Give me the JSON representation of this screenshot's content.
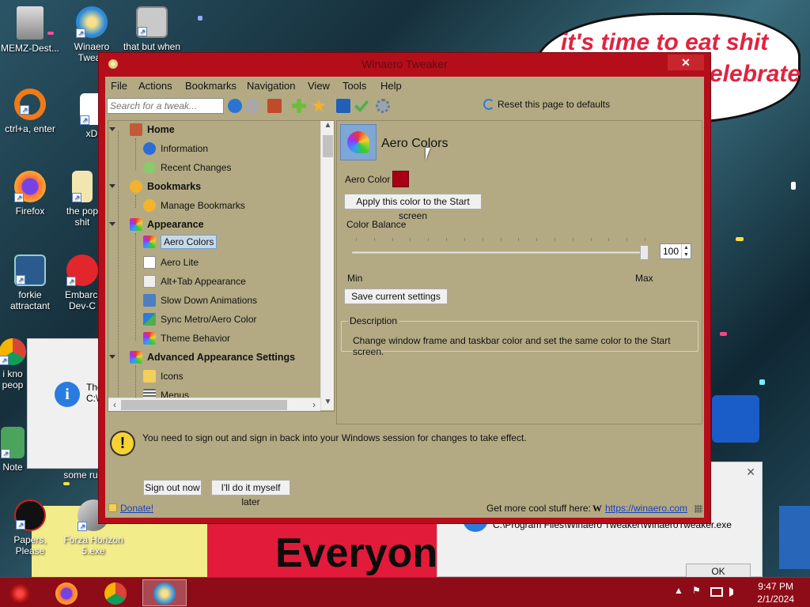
{
  "desktop": {
    "meme_text_1": "it's time to eat shit",
    "meme_text_2": "elebrate",
    "banner_text": "Everyon",
    "icons": [
      {
        "label": "MEMZ-Dest..."
      },
      {
        "label": "Winaero Tweak"
      },
      {
        "label": "that but when"
      },
      {
        "label": "ctrl+a, enter"
      },
      {
        "label": "xD"
      },
      {
        "label": "Firefox"
      },
      {
        "label": "the pop shit"
      },
      {
        "label": "forkie attractant"
      },
      {
        "label": "Embarca Dev-C"
      },
      {
        "label": "i kno peop"
      },
      {
        "label": "Note"
      },
      {
        "label": "some ru"
      },
      {
        "label": "Papers, Please"
      },
      {
        "label": "Forza Horizon 5.exe"
      }
    ],
    "bg_dialog_left_text": "The C:\\",
    "bg_dialog_right_path": "C:\\Program Files\\Winaero Tweaker\\WinaeroTweaker.exe",
    "bg_dialog_right_ok": "OK",
    "close_glyph": "✕"
  },
  "window": {
    "title": "Winaero Tweaker",
    "close_glyph": "✕",
    "menu": [
      "File",
      "Actions",
      "Bookmarks",
      "Navigation",
      "View",
      "Tools",
      "Help"
    ],
    "search_placeholder": "Search for a tweak...",
    "reset_label": "Reset this page to defaults"
  },
  "tree": {
    "nodes": [
      {
        "label": "Home",
        "level": 0,
        "icon": "home-icon"
      },
      {
        "label": "Information",
        "level": 1,
        "icon": "info-icon"
      },
      {
        "label": "Recent Changes",
        "level": 1,
        "icon": "recent-icon"
      },
      {
        "label": "Bookmarks",
        "level": 0,
        "icon": "star-icon"
      },
      {
        "label": "Manage Bookmarks",
        "level": 1,
        "icon": "star-icon"
      },
      {
        "label": "Appearance",
        "level": 0,
        "icon": "palette-icon"
      },
      {
        "label": "Aero Colors",
        "level": 1,
        "icon": "palette-icon",
        "selected": true
      },
      {
        "label": "Aero Lite",
        "level": 1,
        "icon": "window-icon"
      },
      {
        "label": "Alt+Tab Appearance",
        "level": 1,
        "icon": "alttab-icon"
      },
      {
        "label": "Slow Down Animations",
        "level": 1,
        "icon": "monitor-icon"
      },
      {
        "label": "Sync Metro/Aero Color",
        "level": 1,
        "icon": "sync-icon"
      },
      {
        "label": "Theme Behavior",
        "level": 1,
        "icon": "palette-icon"
      },
      {
        "label": "Advanced Appearance Settings",
        "level": 0,
        "icon": "palette-icon"
      },
      {
        "label": "Icons",
        "level": 1,
        "icon": "folder-icon"
      },
      {
        "label": "Menus",
        "level": 1,
        "icon": "menu-icon"
      }
    ]
  },
  "panel": {
    "title": "Aero Colors",
    "aero_color_label": "Aero Color",
    "aero_color_value": "#a80012",
    "apply_button": "Apply this color to the Start screen",
    "color_balance_label": "Color Balance",
    "slider_value": "100",
    "slider_fraction": 1.0,
    "min_label": "Min",
    "max_label": "Max",
    "save_button": "Save current settings",
    "description_legend": "Description",
    "description_text": "Change window frame and taskbar color and set the same color to the Start screen."
  },
  "notice": {
    "text": "You need to sign out and sign in back into your Windows session for changes to take effect.",
    "sign_out_button": "Sign out now",
    "later_button": "I'll do it myself later"
  },
  "footer": {
    "donate": "Donate!",
    "more_label": "Get more cool stuff here:",
    "w_glyph": "W",
    "url": "https://winaero.com"
  },
  "taskbar": {
    "time": "9:47 PM",
    "date": "2/1/2024",
    "up_arrow": "▲",
    "flag": "⚑"
  },
  "colors": {
    "window_frame": "#b50e1b",
    "client_bg": "#b3aa84",
    "taskbar": "#8e0c17",
    "link": "#1a3fbe"
  }
}
